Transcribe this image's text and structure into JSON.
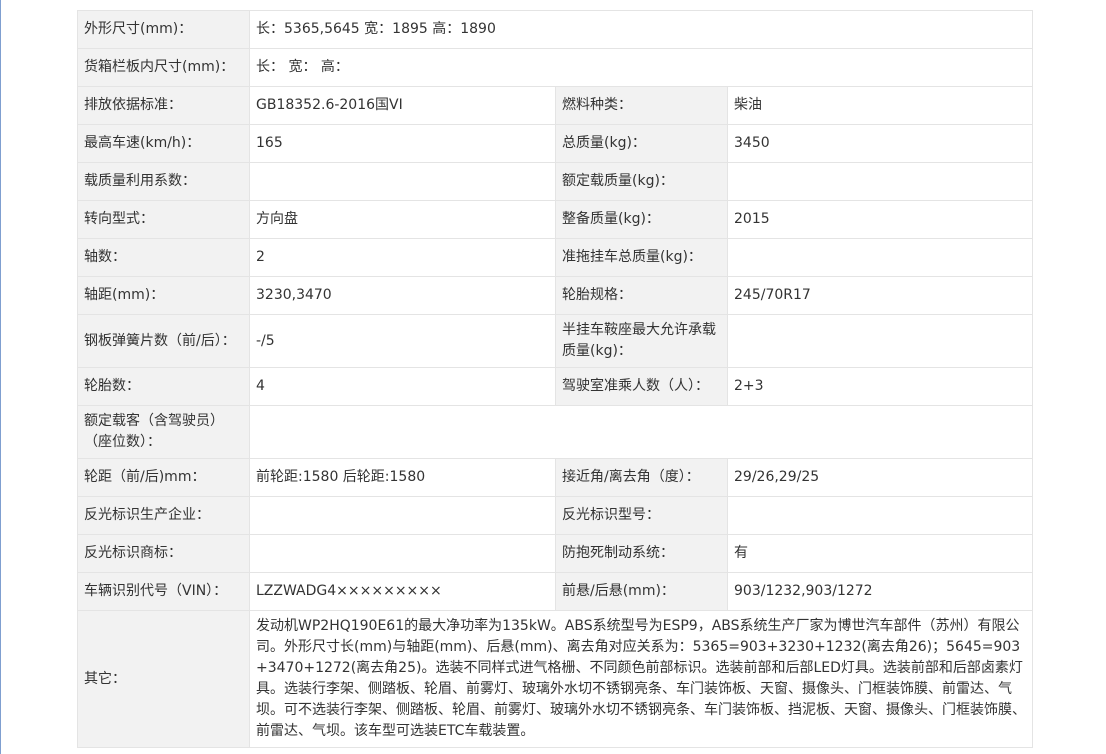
{
  "rows": [
    {
      "cols": 2,
      "l1": "外形尺寸(mm)：",
      "v1": "长：5365,5645 宽：1895 高：1890"
    },
    {
      "cols": 2,
      "l1": "货箱栏板内尺寸(mm)：",
      "v1": "长： 宽： 高："
    },
    {
      "cols": 4,
      "l1": "排放依据标准：",
      "v1": "GB18352.6-2016国VI",
      "l2": "燃料种类：",
      "v2": "柴油"
    },
    {
      "cols": 4,
      "l1": "最高车速(km/h)：",
      "v1": "165",
      "l2": "总质量(kg)：",
      "v2": "3450"
    },
    {
      "cols": 4,
      "l1": "载质量利用系数：",
      "v1": "",
      "l2": "额定载质量(kg)：",
      "v2": ""
    },
    {
      "cols": 4,
      "l1": "转向型式：",
      "v1": "方向盘",
      "l2": "整备质量(kg)：",
      "v2": "2015"
    },
    {
      "cols": 4,
      "l1": "轴数：",
      "v1": "2",
      "l2": "准拖挂车总质量(kg)：",
      "v2": ""
    },
    {
      "cols": 4,
      "l1": "轴距(mm)：",
      "v1": "3230,3470",
      "l2": "轮胎规格：",
      "v2": "245/70R17"
    },
    {
      "cols": 4,
      "l1": "钢板弹簧片数（前/后）：",
      "v1": "-/5",
      "l2": "半挂车鞍座最大允许承载质量(kg)：",
      "v2": ""
    },
    {
      "cols": 4,
      "l1": "轮胎数：",
      "v1": "4",
      "l2": "驾驶室准乘人数（人）：",
      "v2": "2+3"
    },
    {
      "cols": 2,
      "l1": "额定载客（含驾驶员）（座位数）：",
      "v1": ""
    },
    {
      "cols": 4,
      "l1": "轮距（前/后)mm：",
      "v1": "前轮距:1580 后轮距:1580",
      "l2": "接近角/离去角（度）：",
      "v2": "29/26,29/25"
    },
    {
      "cols": 4,
      "l1": "反光标识生产企业：",
      "v1": "",
      "l2": "反光标识型号：",
      "v2": ""
    },
    {
      "cols": 4,
      "l1": "反光标识商标：",
      "v1": "",
      "l2": "防抱死制动系统：",
      "v2": "有"
    },
    {
      "cols": 4,
      "l1": "车辆识别代号（VIN）：",
      "v1": "LZZWADG4×××××××××",
      "l2": "前悬/后悬(mm)：",
      "v2": "903/1232,903/1272"
    },
    {
      "cols": 2,
      "l1": "其它：",
      "v1": "发动机WP2HQ190E61的最大净功率为135kW。ABS系统型号为ESP9，ABS系统生产厂家为博世汽车部件（苏州）有限公司。外形尺寸长(mm)与轴距(mm)、后悬(mm)、离去角对应关系为：5365=903+3230+1232(离去角26)；5645=903+3470+1272(离去角25)。选装不同样式进气格栅、不同颜色前部标识。选装前部和后部LED灯具。选装前部和后部卤素灯具。选装行李架、侧踏板、轮眉、前雾灯、玻璃外水切不锈钢亮条、车门装饰板、天窗、摄像头、门框装饰膜、前雷达、气坝。可不选装行李架、侧踏板、轮眉、前雾灯、玻璃外水切不锈钢亮条、车门装饰板、挡泥板、天窗、摄像头、门框装饰膜、前雷达、气坝。该车型可选装ETC车载装置。"
    }
  ]
}
